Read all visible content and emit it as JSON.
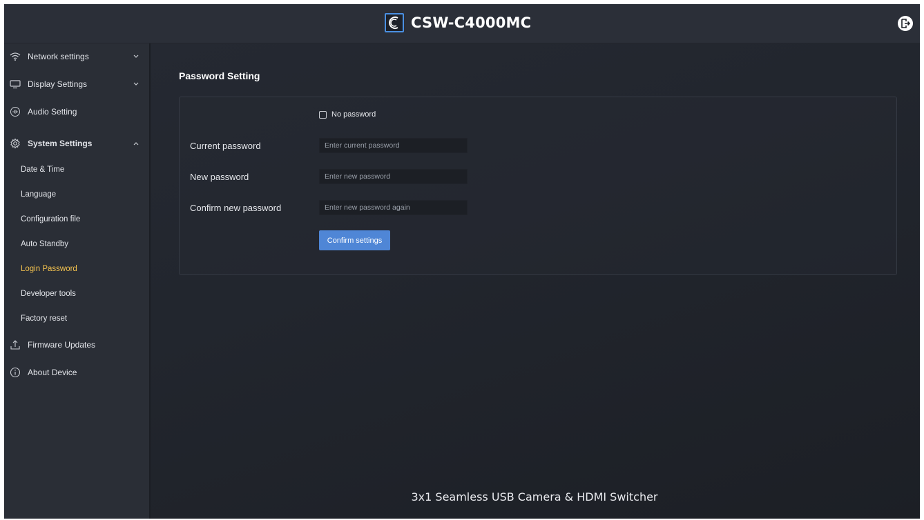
{
  "header": {
    "title": "CSW-C4000MC",
    "logo_letter": "C",
    "logout_icon": "logout-icon"
  },
  "sidebar": {
    "items": [
      {
        "label": "Network settings",
        "icon": "wifi-icon",
        "chevron": "down"
      },
      {
        "label": "Display Settings",
        "icon": "monitor-icon",
        "chevron": "down"
      },
      {
        "label": "Audio Setting",
        "icon": "audio-icon"
      },
      {
        "label": "System Settings",
        "icon": "gear-icon",
        "chevron": "up",
        "expanded": true
      }
    ],
    "system_sub": [
      {
        "label": "Date & Time"
      },
      {
        "label": "Language"
      },
      {
        "label": "Configuration file"
      },
      {
        "label": "Auto Standby"
      },
      {
        "label": "Login Password",
        "active": true
      },
      {
        "label": "Developer tools"
      },
      {
        "label": "Factory reset"
      }
    ],
    "bottom_items": [
      {
        "label": "Firmware Updates",
        "icon": "upload-icon"
      },
      {
        "label": "About Device",
        "icon": "info-icon"
      }
    ]
  },
  "main": {
    "title": "Password Setting",
    "no_password_label": "No password",
    "no_password_checked": false,
    "fields": [
      {
        "label": "Current password",
        "placeholder": "Enter current password",
        "value": ""
      },
      {
        "label": "New password",
        "placeholder": "Enter new password",
        "value": ""
      },
      {
        "label": "Confirm new password",
        "placeholder": "Enter new password again",
        "value": ""
      }
    ],
    "confirm_label": "Confirm settings"
  },
  "footer": {
    "text": "3x1 Seamless USB Camera & HDMI Switcher"
  },
  "colors": {
    "accent": "#4f86d6",
    "active_nav": "#f2c14e",
    "sidebar_bg": "#2a2e36",
    "main_bg": "#22262e"
  }
}
